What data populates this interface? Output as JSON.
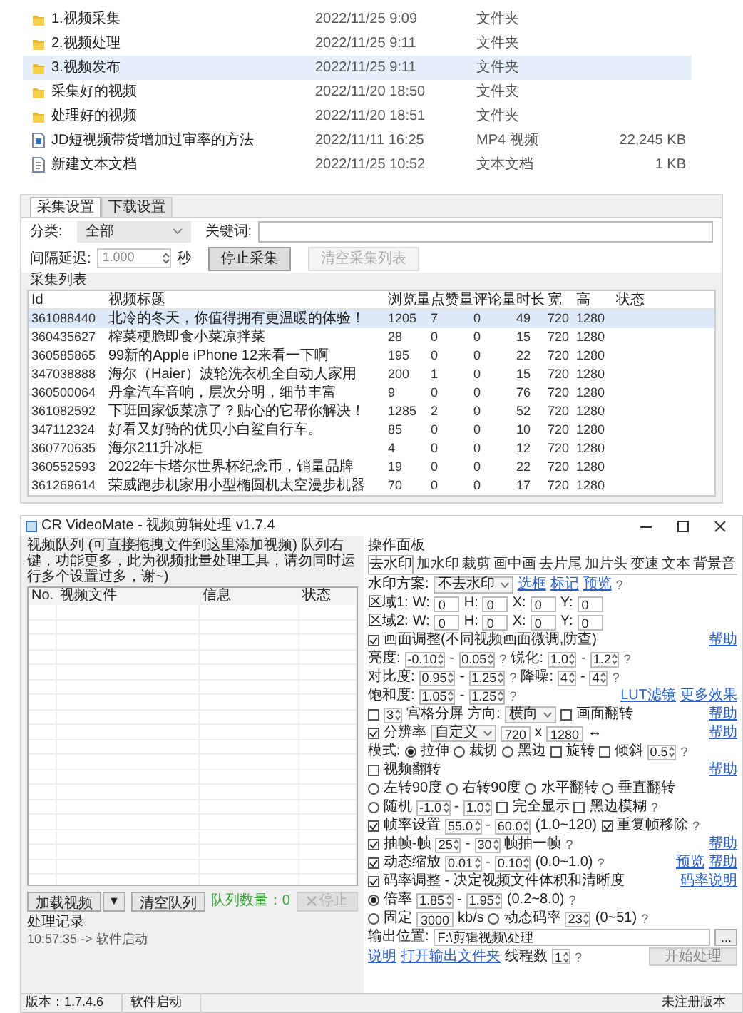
{
  "files": [
    {
      "kind": "folder",
      "name": "1.视频采集",
      "date": "2022/11/25 9:09",
      "type": "文件夹",
      "selected": false
    },
    {
      "kind": "folder",
      "name": "2.视频处理",
      "date": "2022/11/25 9:11",
      "type": "文件夹",
      "selected": false
    },
    {
      "kind": "folder",
      "name": "3.视频发布",
      "date": "2022/11/25 9:11",
      "type": "文件夹",
      "selected": true
    },
    {
      "kind": "folder",
      "name": "采集好的视频",
      "date": "2022/11/20 18:50",
      "type": "文件夹",
      "selected": false
    },
    {
      "kind": "folder",
      "name": "处理好的视频",
      "date": "2022/11/20 18:51",
      "type": "文件夹",
      "selected": false
    },
    {
      "kind": "video",
      "name": "JD短视频带货增加过审率的方法",
      "date": "2022/11/11 16:25",
      "type": "MP4 视频",
      "size": "22,245 KB",
      "selected": false
    },
    {
      "kind": "text",
      "name": "新建文本文档",
      "date": "2022/11/25 10:52",
      "type": "文本文档",
      "size": "1 KB",
      "selected": false
    }
  ],
  "collector": {
    "tabs": [
      {
        "label": "采集设置",
        "selected": true
      },
      {
        "label": "下载设置",
        "selected": false
      }
    ],
    "category_label": "分类:",
    "category": "全部",
    "keyword_label": "关键词:",
    "interval_label": "间隔延迟:",
    "interval": "1.000",
    "interval_unit": "秒",
    "buttons": [
      {
        "label": "停止采集",
        "disabled": false
      },
      {
        "label": "清空采集列表",
        "disabled": true
      }
    ],
    "list_title": "采集列表",
    "columns": [
      "Id",
      "视频标题",
      "浏览量",
      "点赞量",
      "评论量",
      "时长",
      "宽",
      "高",
      "状态"
    ],
    "rows": [
      {
        "selected": true,
        "cells": [
          "361088440",
          "北冷的冬天，你值得拥有更温暖的体验！",
          "1205",
          "7",
          "0",
          "49",
          "720",
          "1280"
        ]
      },
      {
        "selected": false,
        "cells": [
          "360435627",
          "榨菜梗脆即食小菜凉拌菜",
          "28",
          "0",
          "0",
          "15",
          "720",
          "1280"
        ]
      },
      {
        "selected": false,
        "cells": [
          "360585865",
          "99新的Apple iPhone 12来看一下啊",
          "195",
          "0",
          "0",
          "22",
          "720",
          "1280"
        ]
      },
      {
        "selected": false,
        "cells": [
          "347038888",
          "海尔（Haier）波轮洗衣机全自动人家用",
          "200",
          "1",
          "0",
          "15",
          "720",
          "1280"
        ]
      },
      {
        "selected": false,
        "cells": [
          "360500064",
          "丹拿汽车音响，层次分明，细节丰富",
          "9",
          "0",
          "0",
          "76",
          "720",
          "1280"
        ]
      },
      {
        "selected": false,
        "cells": [
          "361082592",
          "下班回家饭菜凉了？贴心的它帮你解决！",
          "1285",
          "2",
          "0",
          "52",
          "720",
          "1280"
        ]
      },
      {
        "selected": false,
        "cells": [
          "347112324",
          "好看又好骑的优贝小白鲨自行车。",
          "85",
          "0",
          "0",
          "10",
          "720",
          "1280"
        ]
      },
      {
        "selected": false,
        "cells": [
          "360770635",
          "海尔211升冰柜",
          "4",
          "0",
          "0",
          "12",
          "720",
          "1280"
        ]
      },
      {
        "selected": false,
        "cells": [
          "360552593",
          "2022年卡塔尔世界杯纪念币，销量品牌",
          "19",
          "0",
          "0",
          "22",
          "720",
          "1280"
        ]
      },
      {
        "selected": false,
        "cells": [
          "361269614",
          "荣威跑步机家用小型椭圆机太空漫步机器",
          "70",
          "0",
          "0",
          "17",
          "720",
          "1280"
        ]
      }
    ]
  },
  "app": {
    "title": "CR VideoMate - 视频剪辑处理 v1.7.4",
    "queue_label": "视频队列 (可直接拖拽文件到这里添加视频) 队列右键，功能更多，此为视频批量处理工具，请勿同时运行多个设置过多，谢~)",
    "queue_columns": [
      "No.",
      "视频文件",
      "信息",
      "状态"
    ],
    "load_button": "加载视频",
    "dropdown": "▼",
    "clear_button": "清空队列",
    "queue_count": "队列数量：0",
    "stop_button": "停止",
    "log_title": "处理记录",
    "log": "10:57:35 -> 软件启动",
    "status": [
      "版本：1.7.4.6",
      "软件启动",
      "未注册版本"
    ],
    "panel": {
      "title": "操作面板",
      "tabs": [
        {
          "label": "去水印",
          "selected": true
        },
        {
          "label": "加水印",
          "selected": false
        },
        {
          "label": "裁剪",
          "selected": false
        },
        {
          "label": "画中画",
          "selected": false
        },
        {
          "label": "去片尾",
          "selected": false
        },
        {
          "label": "加片头",
          "selected": false
        },
        {
          "label": "变速",
          "selected": false
        },
        {
          "label": "文本",
          "selected": false
        },
        {
          "label": "背景音",
          "selected": false
        }
      ],
      "lines": [
        {
          "items": [
            {
              "kind": "text",
              "text": "水印方案:"
            },
            {
              "kind": "select",
              "value": "不去水印"
            },
            {
              "kind": "link",
              "text": "选框"
            },
            {
              "kind": "link",
              "text": "标记"
            },
            {
              "kind": "link",
              "text": "预览"
            },
            {
              "kind": "help",
              "text": "?"
            }
          ]
        },
        {
          "items": [
            {
              "kind": "text",
              "text": "区域1:"
            },
            {
              "kind": "text",
              "text": "W:"
            },
            {
              "kind": "input",
              "value": "0"
            },
            {
              "kind": "text",
              "text": "H:"
            },
            {
              "kind": "input",
              "value": "0"
            },
            {
              "kind": "text",
              "text": "X:"
            },
            {
              "kind": "input",
              "value": "0"
            },
            {
              "kind": "text",
              "text": "Y:"
            },
            {
              "kind": "input",
              "value": "0"
            }
          ]
        },
        {
          "items": [
            {
              "kind": "text",
              "text": "区域2:"
            },
            {
              "kind": "text",
              "text": "W:"
            },
            {
              "kind": "input",
              "value": "0"
            },
            {
              "kind": "text",
              "text": "H:"
            },
            {
              "kind": "input",
              "value": "0"
            },
            {
              "kind": "text",
              "text": "X:"
            },
            {
              "kind": "input",
              "value": "0"
            },
            {
              "kind": "text",
              "text": "Y:"
            },
            {
              "kind": "input",
              "value": "0"
            }
          ]
        },
        {
          "items": [
            {
              "kind": "check",
              "text": "画面调整(不同视频画面微调,防查)",
              "checked": true
            },
            {
              "kind": "rlink",
              "text": "帮助"
            }
          ]
        },
        {
          "items": [
            {
              "kind": "text",
              "text": "亮度:"
            },
            {
              "kind": "spin",
              "value": "-0.10"
            },
            {
              "kind": "text",
              "text": "-"
            },
            {
              "kind": "spin",
              "value": "0.05"
            },
            {
              "kind": "help",
              "text": "?"
            },
            {
              "kind": "text",
              "text": "锐化:"
            },
            {
              "kind": "spin",
              "value": "1.0"
            },
            {
              "kind": "text",
              "text": "-"
            },
            {
              "kind": "spin",
              "value": "1.2"
            },
            {
              "kind": "help",
              "text": "?"
            }
          ]
        },
        {
          "items": [
            {
              "kind": "text",
              "text": "对比度:"
            },
            {
              "kind": "spin",
              "value": "0.95"
            },
            {
              "kind": "text",
              "text": "-"
            },
            {
              "kind": "spin",
              "value": "1.25"
            },
            {
              "kind": "help",
              "text": "?"
            },
            {
              "kind": "text",
              "text": "降噪:"
            },
            {
              "kind": "spin",
              "value": "4"
            },
            {
              "kind": "text",
              "text": "-"
            },
            {
              "kind": "spin",
              "value": "4"
            },
            {
              "kind": "help",
              "text": "?"
            }
          ]
        },
        {
          "items": [
            {
              "kind": "text",
              "text": "饱和度:"
            },
            {
              "kind": "spin",
              "value": "1.05"
            },
            {
              "kind": "text",
              "text": "-"
            },
            {
              "kind": "spin",
              "value": "1.25"
            },
            {
              "kind": "help",
              "text": "?"
            },
            {
              "kind": "rlink",
              "text": "LUT滤镜"
            },
            {
              "kind": "link",
              "text": "更多效果"
            }
          ]
        },
        {
          "items": [
            {
              "kind": "check",
              "checked": false
            },
            {
              "kind": "spin",
              "value": "3"
            },
            {
              "kind": "text",
              "text": "宫格分屏"
            },
            {
              "kind": "text",
              "text": "方向:"
            },
            {
              "kind": "select",
              "value": "横向"
            },
            {
              "kind": "check",
              "text": "画面翻转",
              "checked": false
            },
            {
              "kind": "rlink",
              "text": "帮助"
            }
          ]
        },
        {
          "items": [
            {
              "kind": "check",
              "text": "分辨率",
              "checked": true
            },
            {
              "kind": "select",
              "value": "自定义"
            },
            {
              "kind": "input",
              "value": "720"
            },
            {
              "kind": "text",
              "text": "x"
            },
            {
              "kind": "input",
              "value": "1280"
            },
            {
              "kind": "text",
              "text": "↔"
            },
            {
              "kind": "rlink",
              "text": "帮助"
            }
          ]
        },
        {
          "items": [
            {
              "kind": "text",
              "text": "模式:"
            },
            {
              "kind": "radio",
              "text": "拉伸",
              "selected": true
            },
            {
              "kind": "radio",
              "text": "裁切",
              "selected": false
            },
            {
              "kind": "radio",
              "text": "黑边",
              "selected": false
            },
            {
              "kind": "check",
              "text": "旋转",
              "checked": false
            },
            {
              "kind": "check",
              "text": "倾斜",
              "checked": false
            },
            {
              "kind": "spin",
              "value": "0.5"
            },
            {
              "kind": "help",
              "text": "?"
            }
          ]
        },
        {
          "items": [
            {
              "kind": "check",
              "text": "视频翻转",
              "checked": false
            },
            {
              "kind": "rlink",
              "text": "帮助"
            }
          ]
        },
        {
          "items": [
            {
              "kind": "radio",
              "text": "左转90度",
              "selected": false
            },
            {
              "kind": "radio",
              "text": "右转90度",
              "selected": false
            },
            {
              "kind": "radio",
              "text": "水平翻转",
              "selected": false
            },
            {
              "kind": "radio",
              "text": "垂直翻转",
              "selected": false
            }
          ]
        },
        {
          "items": [
            {
              "kind": "radio",
              "text": "随机",
              "selected": false
            },
            {
              "kind": "spin",
              "value": "-1.0"
            },
            {
              "kind": "text",
              "text": "-"
            },
            {
              "kind": "spin",
              "value": "1.0"
            },
            {
              "kind": "check",
              "text": "完全显示",
              "checked": false
            },
            {
              "kind": "check",
              "text": "黑边模糊",
              "checked": false
            },
            {
              "kind": "help",
              "text": "?"
            }
          ]
        },
        {
          "items": [
            {
              "kind": "check",
              "text": "帧率设置",
              "checked": true
            },
            {
              "kind": "spin",
              "value": "55.0"
            },
            {
              "kind": "text",
              "text": "-"
            },
            {
              "kind": "spin",
              "value": "60.0"
            },
            {
              "kind": "text",
              "text": "(1.0~120)"
            },
            {
              "kind": "check",
              "text": "重复帧移除",
              "checked": true
            },
            {
              "kind": "help",
              "text": "?"
            }
          ]
        },
        {
          "items": [
            {
              "kind": "check",
              "text": "抽帧-帧",
              "checked": true
            },
            {
              "kind": "spin",
              "value": "25"
            },
            {
              "kind": "text",
              "text": "-"
            },
            {
              "kind": "spin",
              "value": "30"
            },
            {
              "kind": "text",
              "text": "帧抽一帧"
            },
            {
              "kind": "help",
              "text": "?"
            },
            {
              "kind": "rlink",
              "text": "帮助"
            }
          ]
        },
        {
          "items": [
            {
              "kind": "check",
              "text": "动态缩放",
              "checked": true
            },
            {
              "kind": "spin",
              "value": "0.01"
            },
            {
              "kind": "text",
              "text": "-"
            },
            {
              "kind": "spin",
              "value": "0.10"
            },
            {
              "kind": "text",
              "text": "(0.0~1.0)"
            },
            {
              "kind": "help",
              "text": "?"
            },
            {
              "kind": "rlink",
              "text": "预览"
            },
            {
              "kind": "link",
              "text": "帮助"
            }
          ]
        },
        {
          "items": [
            {
              "kind": "check",
              "text": "码率调整 - 决定视频文件体积和清晰度",
              "checked": true
            },
            {
              "kind": "rlink",
              "text": "码率说明"
            }
          ]
        },
        {
          "items": [
            {
              "kind": "radio",
              "text": "倍率",
              "selected": true
            },
            {
              "kind": "spin",
              "value": "1.85"
            },
            {
              "kind": "text",
              "text": "-"
            },
            {
              "kind": "spin",
              "value": "1.95"
            },
            {
              "kind": "text",
              "text": "(0.2~8.0)"
            },
            {
              "kind": "help",
              "text": "?"
            }
          ]
        },
        {
          "items": [
            {
              "kind": "radio",
              "text": "固定",
              "selected": false
            },
            {
              "kind": "input",
              "value": "3000"
            },
            {
              "kind": "text",
              "text": "kb/s"
            },
            {
              "kind": "radio",
              "text": "动态码率",
              "selected": false
            },
            {
              "kind": "spin",
              "value": "23"
            },
            {
              "kind": "text",
              "text": "(0~51)"
            },
            {
              "kind": "help",
              "text": "?"
            }
          ]
        },
        {
          "items": [
            {
              "kind": "text",
              "text": "输出位置:"
            },
            {
              "kind": "path",
              "value": "F:\\剪辑视频\\处理"
            },
            {
              "kind": "button",
              "text": "..."
            }
          ]
        },
        {
          "items": [
            {
              "kind": "link",
              "text": "说明"
            },
            {
              "kind": "link",
              "text": "打开输出文件夹"
            },
            {
              "kind": "text",
              "text": "线程数"
            },
            {
              "kind": "spin",
              "value": "1"
            },
            {
              "kind": "help",
              "text": "?"
            },
            {
              "kind": "bigbutton",
              "text": "开始处理"
            }
          ]
        }
      ]
    }
  }
}
